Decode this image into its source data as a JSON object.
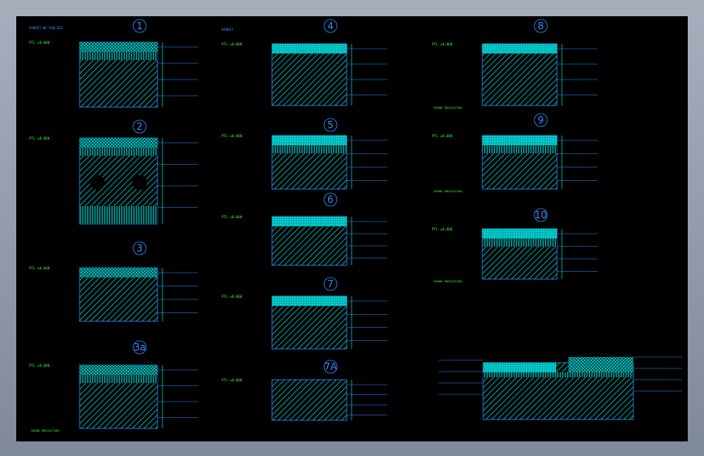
{
  "colors": {
    "background": "#000000",
    "frame": "#8d96a6",
    "outline": "#2d8cff",
    "hatch": "#00ffff",
    "text_green": "#2bff2b",
    "text_blue": "#2d8cff"
  },
  "details": [
    {
      "num": "1",
      "title1": "PARKET NA PODLOZE",
      "title2": "",
      "level": "PTL ±0,000",
      "sublevel": "",
      "bottom": ""
    },
    {
      "num": "2",
      "title1": "",
      "title2": "",
      "level": "PTL ±0,000",
      "sublevel": "",
      "bottom": ""
    },
    {
      "num": "3",
      "title1": "",
      "title2": "",
      "level": "PTL ±0,000",
      "sublevel": "",
      "bottom": ""
    },
    {
      "num": "3a",
      "title1": "",
      "title2": "",
      "level": "PTL ±0,000",
      "sublevel": "SOUND INSULATION",
      "bottom": ""
    },
    {
      "num": "4",
      "title1": "PARKET",
      "title2": "",
      "level": "PTL ±0,000",
      "sublevel": "",
      "bottom": ""
    },
    {
      "num": "5",
      "title1": "",
      "title2": "",
      "level": "PTL ±0,000",
      "sublevel": "",
      "bottom": ""
    },
    {
      "num": "6",
      "title1": "",
      "title2": "",
      "level": "PTL ±0,000",
      "sublevel": "",
      "bottom": ""
    },
    {
      "num": "7",
      "title1": "",
      "title2": "",
      "level": "PTL ±0,000",
      "sublevel": "",
      "bottom": ""
    },
    {
      "num": "7A",
      "title1": "",
      "title2": "",
      "level": "PTL ±0,000",
      "sublevel": "",
      "bottom": ""
    },
    {
      "num": "8",
      "title1": "",
      "title2": "",
      "level": "PTL ±0,000",
      "sublevel": "SOUND INSULATION",
      "bottom": ""
    },
    {
      "num": "9",
      "title1": "",
      "title2": "",
      "level": "PTL ±0,000",
      "sublevel": "SOUND INSULATION",
      "bottom": ""
    },
    {
      "num": "10",
      "title1": "",
      "title2": "",
      "level": "PTL ±0,000",
      "sublevel": "SOUND INSULATION",
      "bottom": ""
    }
  ]
}
